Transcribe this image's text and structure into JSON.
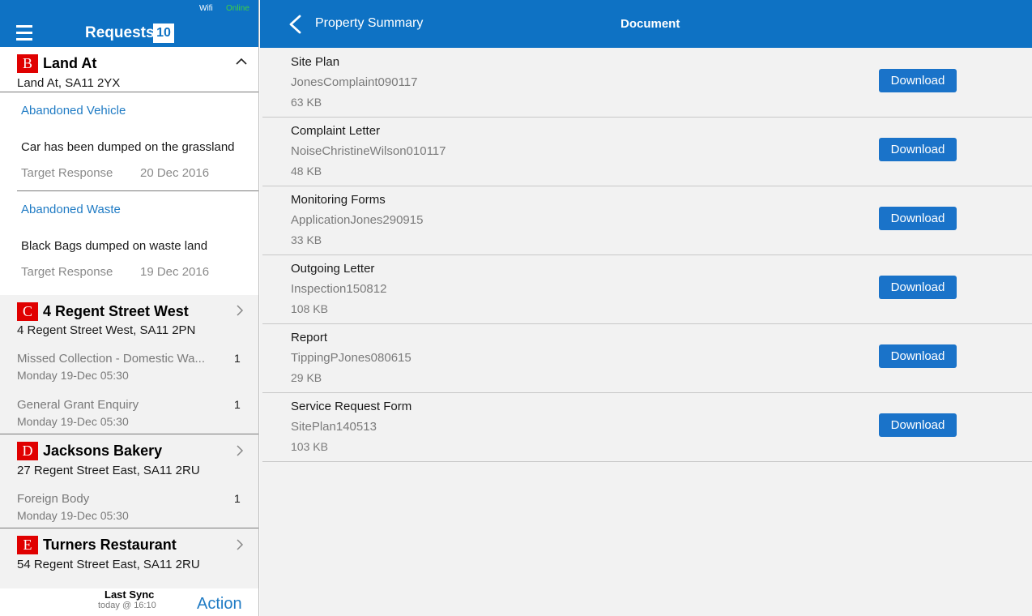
{
  "status": {
    "wifi": "Wifi",
    "online": "Online"
  },
  "left_header": {
    "title": "Requests",
    "count": "10"
  },
  "properties": [
    {
      "badge": "B",
      "name": "Land At",
      "address": "Land At, SA11 2YX",
      "requests": [
        {
          "category": "Abandoned Vehicle",
          "description": "Car has been dumped on the grassland",
          "target_label": "Target Response",
          "target_date": "20 Dec 2016"
        },
        {
          "category": "Abandoned Waste",
          "description": "Black Bags dumped on waste land",
          "target_label": "Target Response",
          "target_date": "19 Dec 2016"
        }
      ]
    },
    {
      "badge": "C",
      "name": "4 Regent Street West",
      "address": "4 Regent Street West, SA11 2PN",
      "items": [
        {
          "title": "Missed Collection - Domestic Wa...",
          "time": "Monday 19-Dec 05:30",
          "count": "1"
        },
        {
          "title": "General Grant Enquiry",
          "time": "Monday 19-Dec 05:30",
          "count": "1"
        }
      ]
    },
    {
      "badge": "D",
      "name": "Jacksons Bakery",
      "address": "27 Regent Street East, SA11 2RU",
      "items": [
        {
          "title": "Foreign Body",
          "time": "Monday 19-Dec 05:30",
          "count": "1"
        }
      ]
    },
    {
      "badge": "E",
      "name": "Turners Restaurant",
      "address": "54 Regent Street East, SA11 2RU"
    }
  ],
  "footer": {
    "last_sync_label": "Last Sync",
    "last_sync_time": "today @ 16:10",
    "action_label": "Action"
  },
  "right_header": {
    "back_label": "Property Summary",
    "title": "Document"
  },
  "download_label": "Download",
  "documents": [
    {
      "name": "Site Plan",
      "file": "JonesComplaint090117",
      "size": "63 KB"
    },
    {
      "name": "Complaint Letter",
      "file": "NoiseChristineWilson010117",
      "size": "48 KB"
    },
    {
      "name": "Monitoring Forms",
      "file": "ApplicationJones290915",
      "size": "33 KB"
    },
    {
      "name": "Outgoing Letter",
      "file": "Inspection150812",
      "size": "108 KB"
    },
    {
      "name": "Report",
      "file": "TippingPJones080615",
      "size": "29 KB"
    },
    {
      "name": "Service Request Form",
      "file": "SitePlan140513",
      "size": "103 KB"
    }
  ],
  "colors": {
    "brand": "#0e72c4",
    "badge": "#e00000",
    "link": "#1f7bc4"
  }
}
